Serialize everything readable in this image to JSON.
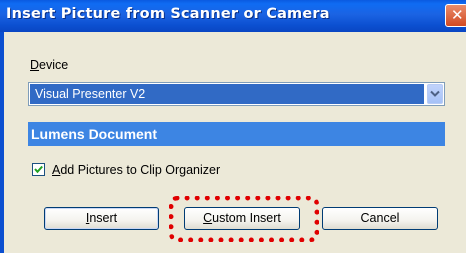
{
  "window": {
    "title": "Insert Picture from Scanner or Camera",
    "close_glyph": "✕"
  },
  "device": {
    "label_mnemonic": "D",
    "label_rest": "evice",
    "selected": "Visual Presenter V2"
  },
  "section": {
    "title": "Lumens Document"
  },
  "option": {
    "checked": true,
    "label_mnemonic": "A",
    "label_rest": "dd Pictures to Clip Organizer"
  },
  "buttons": {
    "insert_mnemonic": "I",
    "insert_rest": "nsert",
    "custom_mnemonic": "C",
    "custom_rest": "ustom Insert",
    "cancel": "Cancel"
  },
  "colors": {
    "title_bar": "#0b4fd0",
    "selection": "#316ac5",
    "section_header": "#3d85e3",
    "highlight_ring": "#e00000"
  }
}
